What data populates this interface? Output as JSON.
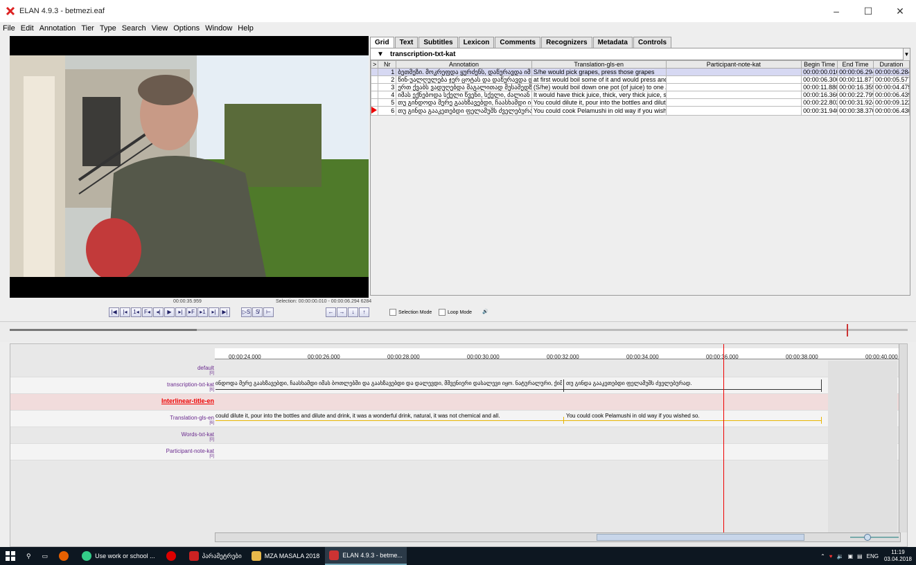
{
  "window": {
    "title": "ELAN 4.9.3 - betmezi.eaf",
    "controls": [
      "–",
      "☐",
      "✕"
    ]
  },
  "menu": [
    "File",
    "Edit",
    "Annotation",
    "Tier",
    "Type",
    "Search",
    "View",
    "Options",
    "Window",
    "Help"
  ],
  "tabs": [
    "Grid",
    "Text",
    "Subtitles",
    "Lexicon",
    "Comments",
    "Recognizers",
    "Metadata",
    "Controls"
  ],
  "grid": {
    "tier": "transcription-txt-kat",
    "columns": [
      ">",
      "Nr",
      "Annotation",
      "Translation-gls-en",
      "Participant-note-kat",
      "Begin Time",
      "End Time",
      "Duration"
    ],
    "rows": [
      {
        "nr": "1",
        "annotation": "ბეთმეზი. მოკრეფდა ყურძენს, დაწურავდა იმ ...",
        "translation": "S/he would pick grapes, press those grapes",
        "note": "",
        "begin": "00:00:00.010",
        "end": "00:00:06.294",
        "duration": "00:00:06.284"
      },
      {
        "nr": "2",
        "annotation": "წინ-უალღულება ჯერ ცოტას და დაწურავდა და ...",
        "translation": "at first would boil some of it and would press and...",
        "note": "",
        "begin": "00:00:06.300",
        "end": "00:00:11.877",
        "duration": "00:00:05.577"
      },
      {
        "nr": "3",
        "annotation": "ერთ ქვაბს ვადუღებდა მაგალითად მესამედზე...",
        "translation": "(S/he) would boil down one pot (of juice) to one /...",
        "note": "",
        "begin": "00:00:11.880",
        "end": "00:00:16.355",
        "duration": "00:00:04.475"
      },
      {
        "nr": "4",
        "annotation": "იმას ექნებოდა სქელი წვენი, სქელი, ძალიან სქ...",
        "translation": "It would have thick juice, thick, very thick juice, s...",
        "note": "",
        "begin": "00:00:16.360",
        "end": "00:00:22.799",
        "duration": "00:00:06.439"
      },
      {
        "nr": "5",
        "annotation": "თუ გინდოდა მერე გაახზავებდი, ჩაასხამდი იმა...",
        "translation": "You could dilute it, pour into the bottles and dilut...",
        "note": "",
        "begin": "00:00:22.802",
        "end": "00:00:31.924",
        "duration": "00:00:09.122"
      },
      {
        "nr": "6",
        "annotation": "თუ გინდა გააკეთებდი ფელამუშს ძველებურა...",
        "translation": "You could cook Pelamushi in old way if you wish...",
        "note": "",
        "begin": "00:00:31.940",
        "end": "00:00:38.370",
        "duration": "00:00:06.430"
      }
    ]
  },
  "media": {
    "current_time": "00:00:35.959",
    "selection": "Selection: 00:00:00.010 - 00:00:06.294 6284",
    "selection_mode": "Selection Mode",
    "loop_mode": "Loop Mode"
  },
  "timeline": {
    "ticks": [
      "00:00:24.000",
      "00:00:26.000",
      "00:00:28.000",
      "00:00:30.000",
      "00:00:32.000",
      "00:00:34.000",
      "00:00:36.000",
      "00:00:38.000",
      "00:00:40.000"
    ],
    "tiers": [
      {
        "name": "default",
        "count": "[0]"
      },
      {
        "name": "transcription-txt-kat",
        "count": "[6]"
      },
      {
        "name": "Interlinear-title-en",
        "count": ""
      },
      {
        "name": "Translation-gls-en",
        "count": "[6]"
      },
      {
        "name": "Words-txt-kat",
        "count": "[0]"
      },
      {
        "name": "Participant-note-kat",
        "count": "[0]"
      }
    ],
    "transcription_a": "ინდოდა მერე გაახზავებდი, ჩაასხამდი იმას ბოთლებში და გაახზავებდი და დალევდი, მშვენიერი დასალევი იყო. ნატურალური, ქიმ",
    "transcription_b": "თუ გინდა გააკეთებდი ფელამუშს ძველებურად.",
    "translation_a": "could dilute it, pour into the bottles and dilute and drink, it was a wonderful drink, natural, it was not chemical and all.",
    "translation_b": "You could cook Pelamushi in old way if you wished so."
  },
  "taskbar": {
    "apps": [
      "Use work or school ...",
      "პარამეტრები",
      "MZA MASALA 2018",
      "ELAN 4.9.3 - betme..."
    ],
    "lang": "ENG",
    "time": "11:19",
    "date": "03.04.2018"
  }
}
